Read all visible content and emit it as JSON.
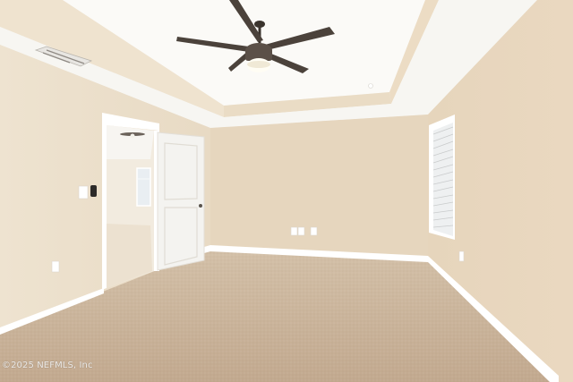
{
  "watermark": {
    "text": "©2025 NEFMLS, Inc"
  },
  "colors": {
    "ceiling": "#f6f5f1",
    "tray_ceiling": "#fbfaf7",
    "left_wall": "#ebdfcb",
    "back_wall": "#e6d6be",
    "right_wall": "#e7d5bd",
    "carpet": "#cbb59d",
    "trim": "#ffffff",
    "door": "#f4f3f0",
    "fan_blade": "#4b423b"
  },
  "icons": [
    "ceiling-fan-icon",
    "light-icon",
    "vent-icon",
    "outlet-icon",
    "switch-icon",
    "smart-lock-icon"
  ]
}
